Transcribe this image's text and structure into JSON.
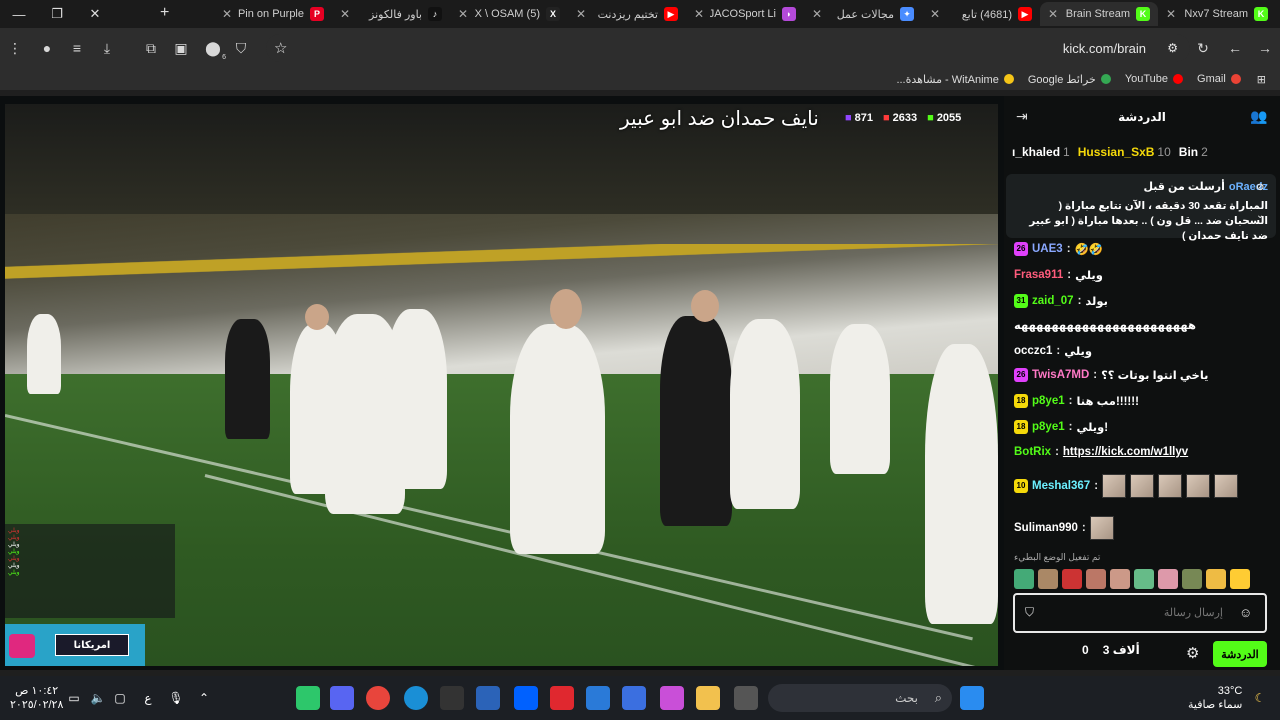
{
  "tabs": [
    {
      "title": "Nxv7 Stream",
      "color": "#53fc18",
      "letter": "K",
      "active": false
    },
    {
      "title": "Brain Stream",
      "color": "#53fc18",
      "letter": "K",
      "active": true
    },
    {
      "title": "(4681) تابع",
      "color": "#ff0000",
      "letter": "▶",
      "active": false
    },
    {
      "title": "مجالات عمل",
      "color": "#4a8cff",
      "letter": "✦",
      "active": false
    },
    {
      "title": "JACOSport Li",
      "color": "#b44ad9",
      "letter": "◗",
      "active": false
    },
    {
      "title": "تختيم ريزدنت",
      "color": "#ff0000",
      "letter": "▶",
      "active": false
    },
    {
      "title": "(5) X \\ OSAM",
      "color": "#222",
      "letter": "X",
      "active": false
    },
    {
      "title": "باور فالكونز",
      "color": "#111",
      "letter": "♪",
      "active": false
    },
    {
      "title": "Pin on Purple",
      "color": "#e60023",
      "letter": "P",
      "active": false
    }
  ],
  "window_controls": {
    "minimize": "—",
    "restore": "❐",
    "close": "✕",
    "new_tab": "+"
  },
  "address": {
    "url": "kick.com/brain"
  },
  "bookmarks": [
    {
      "label": "Gmail",
      "color": "#ea4335"
    },
    {
      "label": "YouTube",
      "color": "#ff0000"
    },
    {
      "label": "خرائط Google",
      "color": "#34a853"
    },
    {
      "label": "WitAnime - مشاهدة...",
      "color": "#f5c518"
    }
  ],
  "extension_badge": "6",
  "video": {
    "caption": "نايف حمدان ضد ابو عبير",
    "stats": [
      {
        "value": "2055",
        "color": "#53fc18"
      },
      {
        "value": "2633",
        "color": "#ff3b3b"
      },
      {
        "value": "871",
        "color": "#9146ff"
      }
    ],
    "ad_text": "امريكانا"
  },
  "chat": {
    "title": "الدردشة",
    "leaderboard": [
      {
        "name": "ı_khaled",
        "rank": "1"
      },
      {
        "name": "Hussian_SxB",
        "rank": "10"
      },
      {
        "name": "Bin",
        "rank": "2"
      }
    ],
    "pinned": {
      "user": "oRaedz",
      "prefix": "أرسلت من قبل",
      "text": "المباراة تقعد 30 دقيقه ، الآن تتابع مباراة ( السحبان ضد ... قل ون ) .. بعدها مباراة ( ابو عبير ضد نايف حمدان )"
    },
    "messages": [
      {
        "user": "UAE3",
        "badge": "26",
        "badge_color": "#e040fb",
        "text": "🤣🤣",
        "color": "#8aa8ff"
      },
      {
        "user": "Frasa911",
        "badge": "",
        "badge_color": "",
        "text": "ويلي",
        "color": "#ff5c7c"
      },
      {
        "user": "zaid_07",
        "badge": "31",
        "badge_color": "#53fc18",
        "text": "بولد",
        "color": "#53fc18"
      },
      {
        "user": "",
        "badge": "",
        "badge_color": "",
        "text": "هههههههههههههههههههههههه",
        "color": "#fff"
      },
      {
        "user": "occzc1",
        "badge": "",
        "badge_color": "",
        "text": "ويلي",
        "color": "#ffffff"
      },
      {
        "user": "TwisA7MD",
        "badge": "26",
        "badge_color": "#e040fb",
        "text": "ياخي انتوا بوتات ؟؟",
        "color": "#ff79c6"
      },
      {
        "user": "p8ye1",
        "badge": "18",
        "badge_color": "#f5d90a",
        "text": "مب هنا!!!!!!",
        "color": "#53fc18"
      },
      {
        "user": "p8ye1",
        "badge": "18",
        "badge_color": "#f5d90a",
        "text": "ويلي!",
        "color": "#53fc18"
      },
      {
        "user": "BotRix",
        "badge": "",
        "badge_color": "",
        "text": "https://kick.com/w1llyv",
        "color": "#53fc18"
      },
      {
        "user": "Meshal367",
        "badge": "10",
        "badge_color": "#f5d90a",
        "text": "",
        "color": "#6cf0ff"
      },
      {
        "user": "Suliman990",
        "badge": "",
        "badge_color": "",
        "text": "",
        "color": "#ffffff"
      }
    ],
    "notice": "تم تفعيل الوضع البطيء",
    "input_placeholder": "إرسال رسالة",
    "send_label": "الدردشة",
    "viewers_label": "3 ألاف",
    "points": "0"
  },
  "taskbar": {
    "search_placeholder": "بحث",
    "time": "١٠:٤٢ ص",
    "date": "٢٠٢٥/٠٢/٢٨",
    "lang": "ع",
    "temperature": "33°C",
    "weather_desc": "سماء صافية"
  }
}
